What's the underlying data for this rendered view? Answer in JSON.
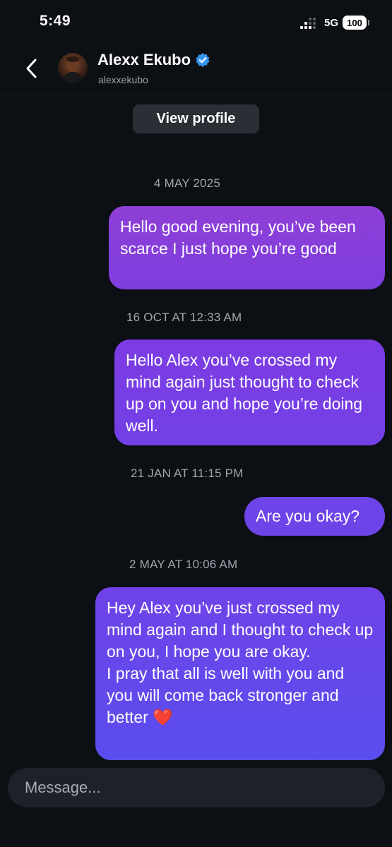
{
  "status_bar": {
    "time": "5:49",
    "network": "5G",
    "battery": "100"
  },
  "header": {
    "back_icon": "chevron-left-icon",
    "name": "Alexx Ekubo",
    "username": "alexxekubo",
    "verified_icon": "verified-badge-icon"
  },
  "view_profile_label": "View profile",
  "conversation": [
    {
      "timestamp": "4 MAY 2025",
      "message": "Hello good evening, you’ve been scarce I just hope you’re good"
    },
    {
      "timestamp": "16 OCT AT 12:33 AM",
      "message": "Hello Alex you’ve crossed my mind again just thought to check up on you and hope you’re doing well."
    },
    {
      "timestamp": "21 JAN AT 11:15 PM",
      "message": "Are you okay?"
    },
    {
      "timestamp": "2 MAY AT 10:06 AM",
      "message": "Hey Alex you’ve just crossed my mind again and I thought to check up on you, I hope you are okay.",
      "message_line2": "I pray that all is well with you and you will come back stronger and better ❤️"
    }
  ],
  "composer": {
    "placeholder": "Message..."
  },
  "colors": {
    "background": "#0c0f14",
    "bubble_top": "#8e3fd6",
    "bubble_bottom": "#5a4dee",
    "verified": "#3897f0"
  }
}
